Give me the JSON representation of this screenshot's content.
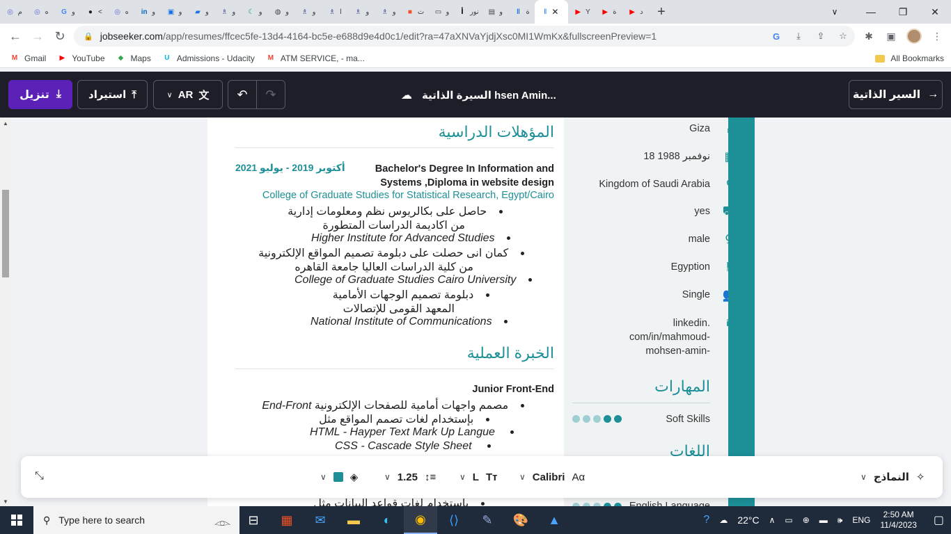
{
  "browser": {
    "tabs": [
      {
        "icon": "◎",
        "label": "م",
        "color": "#5f6ad6"
      },
      {
        "icon": "◎",
        "label": "ه",
        "color": "#5f6ad6"
      },
      {
        "icon": "G",
        "label": "و",
        "color": "#4285f4"
      },
      {
        "icon": "●",
        "label": "<",
        "color": "#202124"
      },
      {
        "icon": "◎",
        "label": "ه",
        "color": "#5f6ad6"
      },
      {
        "icon": "in",
        "label": "و",
        "color": "#0a66c2"
      },
      {
        "icon": "▣",
        "label": "و",
        "color": "#1a73e8"
      },
      {
        "icon": "▰",
        "label": "و",
        "color": "#1a73e8"
      },
      {
        "icon": "♗",
        "label": "و",
        "color": "#3c4a8c"
      },
      {
        "icon": "☾",
        "label": "و",
        "color": "#16a34a"
      },
      {
        "icon": "◍",
        "label": "و",
        "color": "#444"
      },
      {
        "icon": "♗",
        "label": "و",
        "color": "#3c4a8c"
      },
      {
        "icon": "♗",
        "label": "ا",
        "color": "#3c4a8c"
      },
      {
        "icon": "♗",
        "label": "و",
        "color": "#3c4a8c"
      },
      {
        "icon": "♗",
        "label": "و",
        "color": "#3c4a8c"
      },
      {
        "icon": "■",
        "label": "ت",
        "color": "#f25022"
      },
      {
        "icon": "▭",
        "label": "و",
        "color": "#333"
      },
      {
        "icon": "أ",
        "label": "نور",
        "color": "#111"
      },
      {
        "icon": "▤",
        "label": "و",
        "color": "#444"
      },
      {
        "icon": "ǁ",
        "label": "ة",
        "color": "#1a73e8"
      }
    ],
    "active_tab": {
      "label": "ǁ",
      "close": "✕"
    },
    "tabs_after": [
      {
        "icon": "▶",
        "label": "Y",
        "color": "#ff0000"
      },
      {
        "icon": "▶",
        "label": "ة",
        "color": "#ff0000"
      },
      {
        "icon": "▶",
        "label": "د",
        "color": "#ff0000"
      }
    ],
    "new_tab": "+",
    "url_host": "jobseeker.com",
    "url_path": "/app/resumes/ffcec5fe-13d4-4164-bc5e-e688d9e4d0c1/edit?ra=47aXNVaYjdjXsc0MI1WmKx&fullscreenPreview=1",
    "bookmarks": [
      {
        "label": "Gmail",
        "icon": "M",
        "color": "#ea4335"
      },
      {
        "label": "YouTube",
        "icon": "▶",
        "color": "#ff0000"
      },
      {
        "label": "Maps",
        "icon": "◆",
        "color": "#34a853"
      },
      {
        "label": "Admissions - Udacity",
        "icon": "U",
        "color": "#02b3e4"
      },
      {
        "label": "ATM SERVICE, - ma...",
        "icon": "M",
        "color": "#ea4335"
      }
    ],
    "all_bookmarks": "All Bookmarks"
  },
  "app": {
    "download_label": "تنزيل",
    "import_label": "استيراد",
    "lang_label": "AR",
    "doc_title": "السيرة الذاتية hsen Amin...",
    "resumes_label": "السير الذاتية"
  },
  "resume": {
    "education_title": "المؤهلات الدراسية",
    "edu_date": "أكتوبر 2019 - يوليو 2021",
    "edu_degree": "Bachelor's  Degree In Information and Systems ,Diploma in website design",
    "edu_college": "College of Graduate Studies for Statistical Research, Egypt/Cairo",
    "edu_bullets": [
      "حاصل على بكالريوس نظم ومعلومات إدارية",
      "من اكاديمة الدراسات المتطورة",
      "Higher Institute for Advanced Studies",
      "كمان انى حصلت على دبلومة تصميم المواقع الإلكترونية",
      "من كلية الدراسات العاليا جامعة القاهره",
      "College of Graduate Studies Cairo University",
      "دبلومة تصميم الوجهات الأمامية",
      "المعهد القومى للإتصالات",
      "National Institute of Communications"
    ],
    "experience_title": "الخبرة العملية",
    "job_title": "Junior Front-End",
    "job_bullets": [
      "مصمم واجهات أمامية للصفحات الإلكترونية",
      "End-Front",
      "بإستخدام لغات تصمم المواقع مثل",
      "HTML - Hayper Text Mark Up Langue",
      "CSS - Cascade Style Sheet",
      "بإستخدام لغات قواعد البيانات مثل"
    ],
    "sidebar": {
      "city": "Giza",
      "birth": "18 نوفمبر 1988",
      "country": "Kingdom of Saudi Arabia",
      "license": "yes",
      "gender": "male",
      "nationality": "Egyption",
      "marital": "Single",
      "linkedin": [
        "linkedin.",
        "com/in/mahmoud-",
        "mohsen-amin-"
      ],
      "skills_title": "المهارات",
      "skill_name": "Soft Skills",
      "skill_level": 2,
      "languages_title": "اللغات",
      "language_name": "English Language"
    }
  },
  "toolbar": {
    "templates_label": "النماذج",
    "font_name": "Calibri",
    "font_size": "L",
    "line_height": "1.25",
    "accent": "#1d9097"
  },
  "taskbar": {
    "search_placeholder": "Type here to search",
    "weather": "22°C",
    "lang": "ENG",
    "time": "2:50 AM",
    "date": "11/4/2023"
  }
}
